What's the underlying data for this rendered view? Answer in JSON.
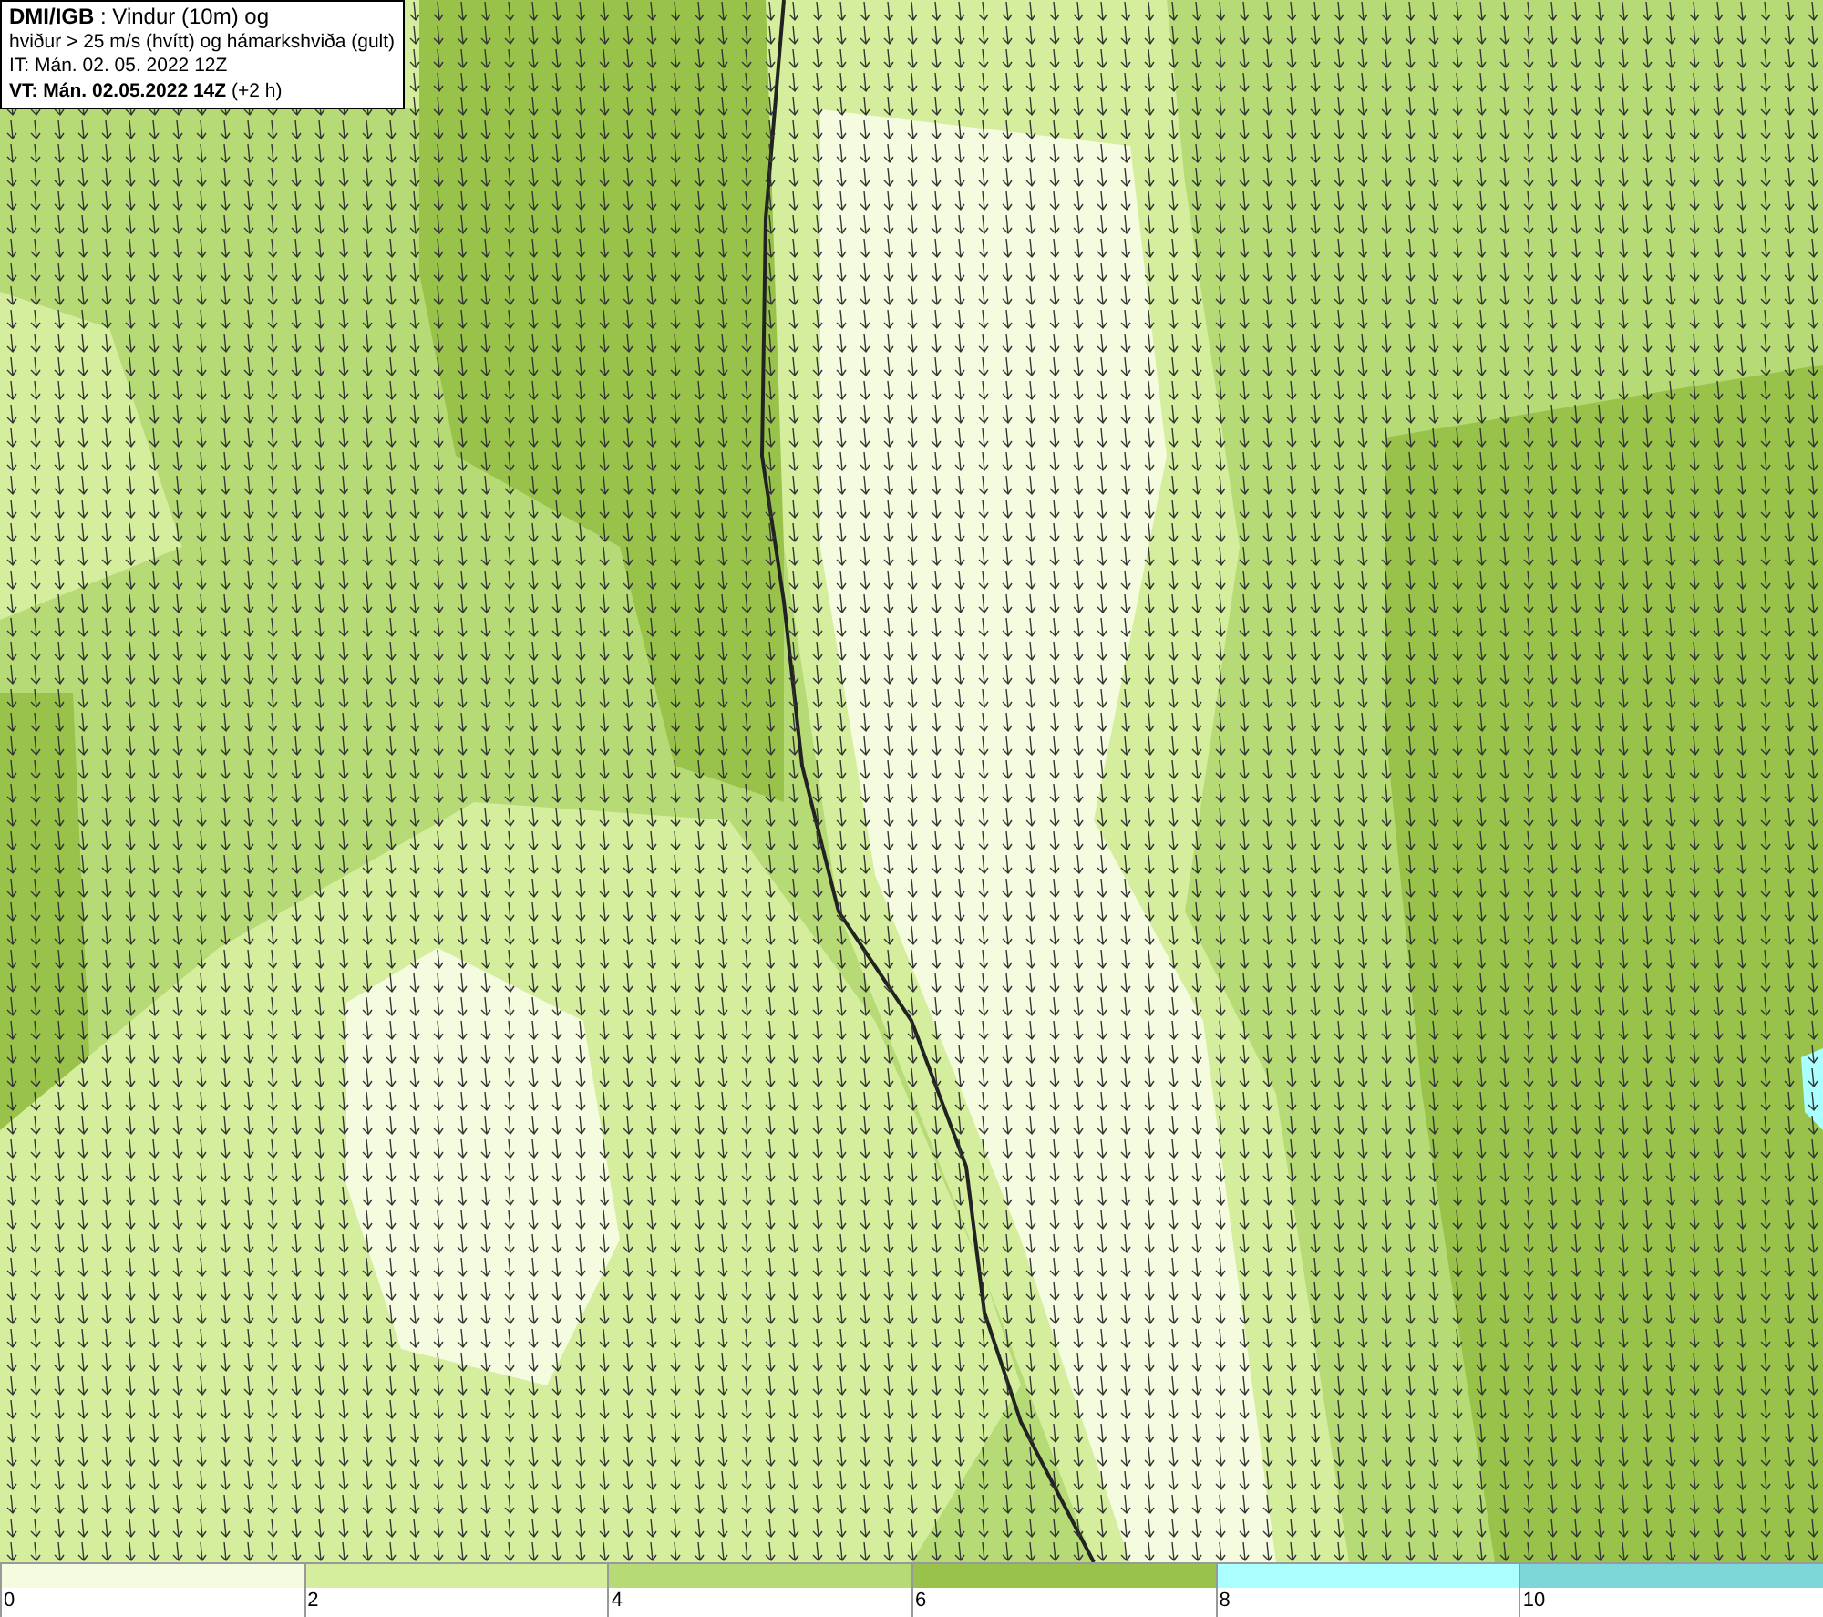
{
  "header": {
    "lines": [
      "**DMI/IGB** : Vindur (10m) og",
      "hviður > 25 m/s (hvítt) og hámarkshviða (gult)",
      "IT: Mán. 02. 05. 2022 12Z",
      "**VT: Mán. 02.05.2022 14Z** (+2 h)"
    ]
  },
  "legend": [
    {
      "label": "0",
      "color": "#f4fbdf"
    },
    {
      "label": "2",
      "color": "#d4ee9e"
    },
    {
      "label": "4",
      "color": "#b6da76"
    },
    {
      "label": "6",
      "color": "#98c24a"
    },
    {
      "label": "8",
      "color": "#aaffff"
    },
    {
      "label": "10",
      "color": "#7dd6d8"
    }
  ]
}
